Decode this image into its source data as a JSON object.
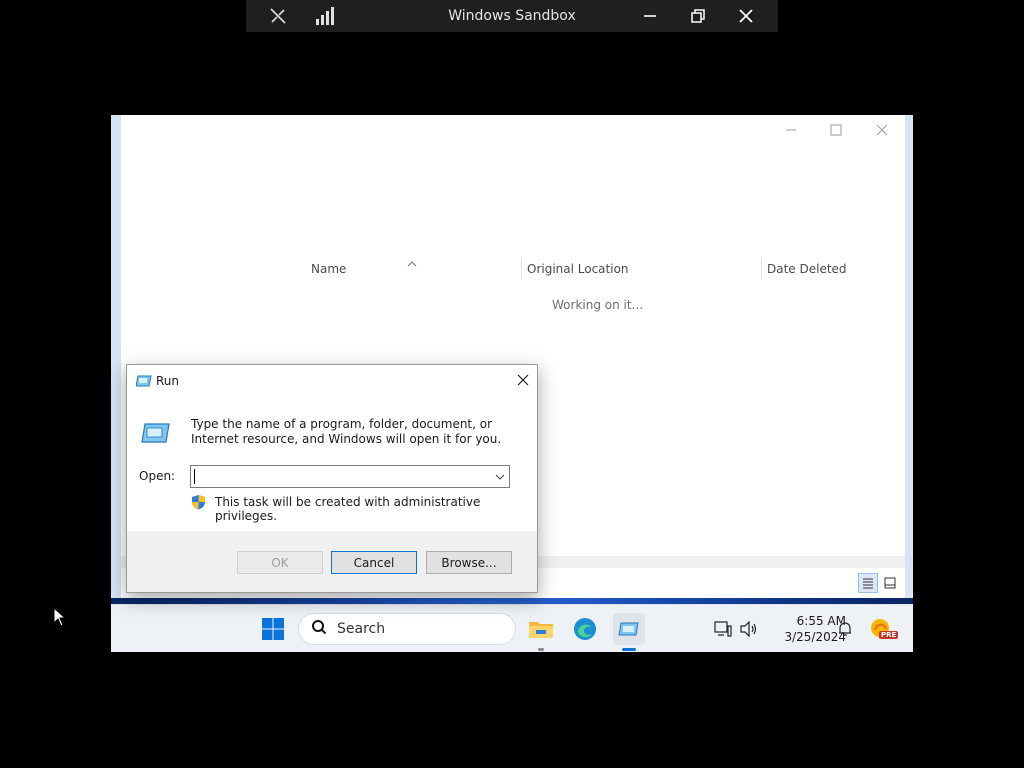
{
  "sandbox": {
    "title": "Windows Sandbox"
  },
  "recycle_bin": {
    "columns": [
      "Name",
      "Original Location",
      "Date Deleted"
    ],
    "status_text": "Working on it..."
  },
  "run_dialog": {
    "title": "Run",
    "description": "Type the name of a program, folder, document, or Internet resource, and Windows will open it for you.",
    "open_label": "Open:",
    "open_value": "",
    "admin_note": "This task will be created with administrative privileges.",
    "buttons": {
      "ok": "OK",
      "cancel": "Cancel",
      "browse": "Browse..."
    }
  },
  "taskbar": {
    "search_label": "Search",
    "time": "6:55 AM",
    "date": "3/25/2024",
    "copilot_badge": "PRE"
  },
  "colors": {
    "taskbar_bg": "#eef1f6",
    "windows_blue": "#0a74da",
    "dialog_footer": "#f0f0f0"
  }
}
